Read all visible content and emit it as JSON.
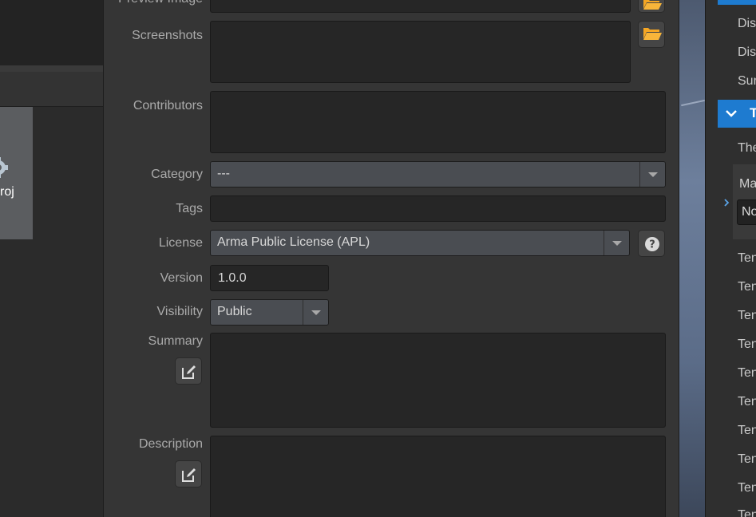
{
  "project": {
    "tile_label": "roj"
  },
  "form": {
    "preview_image_label": "Preview Image",
    "screenshots_label": "Screenshots",
    "contributors_label": "Contributors",
    "category_label": "Category",
    "category_value": "---",
    "tags_label": "Tags",
    "license_label": "License",
    "license_value": "Arma Public License (APL)",
    "version_label": "Version",
    "version_value": "1.0.0",
    "visibility_label": "Visibility",
    "visibility_value": "Public",
    "summary_label": "Summary",
    "description_label": "Description"
  },
  "right_panel": {
    "items_top": [
      "Dis",
      "Dis",
      "Sur"
    ],
    "section_title": "T",
    "item_the": "The",
    "group_label": "Ma",
    "group_input_value": "No",
    "items_bottom": [
      "Ten",
      "Ten",
      "Ten",
      "Ten",
      "Ten",
      "Ten",
      "Ten",
      "Ten",
      "Ten",
      "Ten"
    ]
  },
  "colors": {
    "accent": "#1e7bd0",
    "folder_icon": "#f5a623",
    "dialog_bg": "#353535",
    "field_bg": "#262626"
  },
  "icons": [
    "gear-icon",
    "folder-open-icon",
    "help-icon",
    "edit-icon",
    "chevron-down-icon",
    "chevron-right-icon"
  ]
}
